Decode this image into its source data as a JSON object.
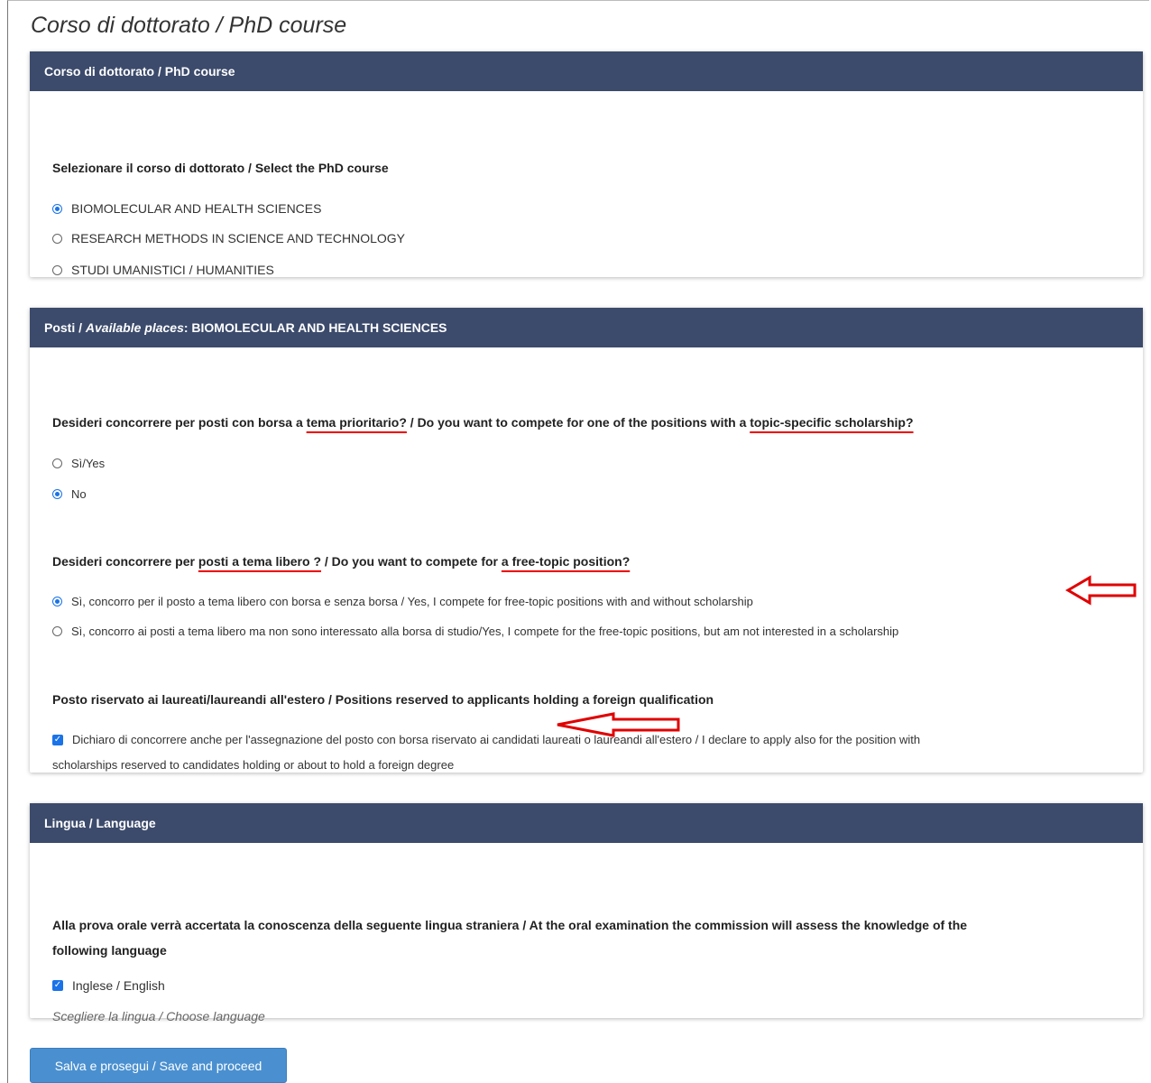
{
  "page_title": "Corso di dottorato / PhD course",
  "course_panel": {
    "header": "Corso di dottorato / PhD course",
    "question": "Selezionare il corso di dottorato / Select the PhD course",
    "options": [
      {
        "label": "BIOMOLECULAR AND HEALTH SCIENCES",
        "selected": true
      },
      {
        "label": "RESEARCH METHODS IN SCIENCE AND TECHNOLOGY",
        "selected": false
      },
      {
        "label": "STUDI UMANISTICI / HUMANITIES",
        "selected": false
      }
    ]
  },
  "places_panel": {
    "header_prefix": "Posti / ",
    "header_italic": "Available places",
    "header_suffix": ": BIOMOLECULAR AND HEALTH SCIENCES",
    "q1": {
      "p1": "Desideri concorrere per posti con borsa a ",
      "u1": "tema prioritario?",
      "p2": " / Do you want to compete for one of the positions with a ",
      "u2": "topic-specific scholarship?"
    },
    "q1_options": [
      {
        "label": "Sì/Yes",
        "selected": false
      },
      {
        "label": "No",
        "selected": true
      }
    ],
    "q2": {
      "p1": "Desideri concorrere per ",
      "u1": "posti a tema libero ?",
      "p2": " / Do you want to compete for ",
      "u2": "a free-topic position?"
    },
    "q2_options": [
      {
        "label": "Sì, concorro per il posto a tema libero con borsa e senza borsa / Yes, I compete for free-topic positions with and without scholarship",
        "selected": true
      },
      {
        "label": "Sì, concorro ai posti a tema libero ma non sono interessato alla borsa di studio/Yes, I compete for the free-topic positions, but am not interested in a scholarship",
        "selected": false
      }
    ],
    "q3": "Posto riservato ai laureati/laureandi all'estero / Positions reserved to applicants holding a foreign qualification",
    "q3_check_line1": "Dichiaro di concorrere anche per l'assegnazione del posto con borsa riservato ai candidati laureati o laureandi all'estero / I declare to apply also for the position with",
    "q3_check_line2": "scholarships reserved to candidates holding or about to hold a foreign degree",
    "q3_checked": true
  },
  "language_panel": {
    "header": "Lingua / Language",
    "question_line1": "Alla prova orale verrà accertata la conoscenza della seguente lingua straniera / At the oral examination the commission will assess the knowledge of the",
    "question_line2": "following language",
    "option": "Inglese / English",
    "option_checked": true,
    "hint": "Scegliere la lingua / Choose language"
  },
  "submit_label": "Salva e prosegui / Save and proceed",
  "colors": {
    "header_bg": "#3c4b6c",
    "accent": "#1a73e8",
    "button": "#4a90d0",
    "annotation": "#e00000"
  }
}
